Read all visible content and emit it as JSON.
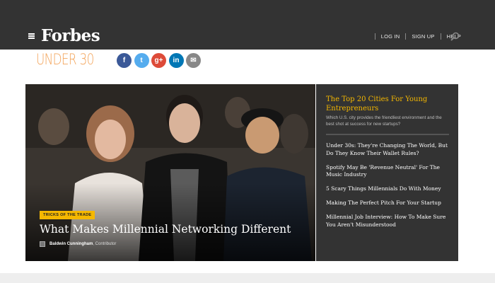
{
  "header": {
    "logo": "Forbes",
    "nav": [
      "LOG IN",
      "SIGN UP",
      "HELP"
    ]
  },
  "section": {
    "title": "UNDER 30"
  },
  "share": {
    "icons": [
      "facebook-icon",
      "twitter-icon",
      "google-plus-icon",
      "linkedin-icon",
      "email-icon"
    ],
    "glyphs": [
      "f",
      "t",
      "g+",
      "in",
      "✉"
    ]
  },
  "hero": {
    "tag": "TRICKS OF THE TRADE",
    "title": "What Makes Millennial Networking Different",
    "author": "Baldwin Cunningham",
    "role": ", Contributor"
  },
  "sidebar": {
    "featured_title": "The Top 20 Cities For Young Entrepreneurs",
    "featured_desc": "Which U.S. city provides the friendliest environment and the best shot at success for new startups?",
    "items": [
      "Under 30s: They're Changing The World, But Do They Know Their Wallet Rules?",
      "Spotify May Be 'Revenue Neutral' For The Music Industry",
      "5 Scary Things Millennials Do With Money",
      "Making The Perfect Pitch For Your Startup",
      "Millennial Job Interview: How To Make Sure You Aren't Misunderstood"
    ]
  },
  "colors": {
    "header_bg": "#333333",
    "accent_orange": "#f3a45a",
    "tag_yellow": "#f5b800"
  }
}
